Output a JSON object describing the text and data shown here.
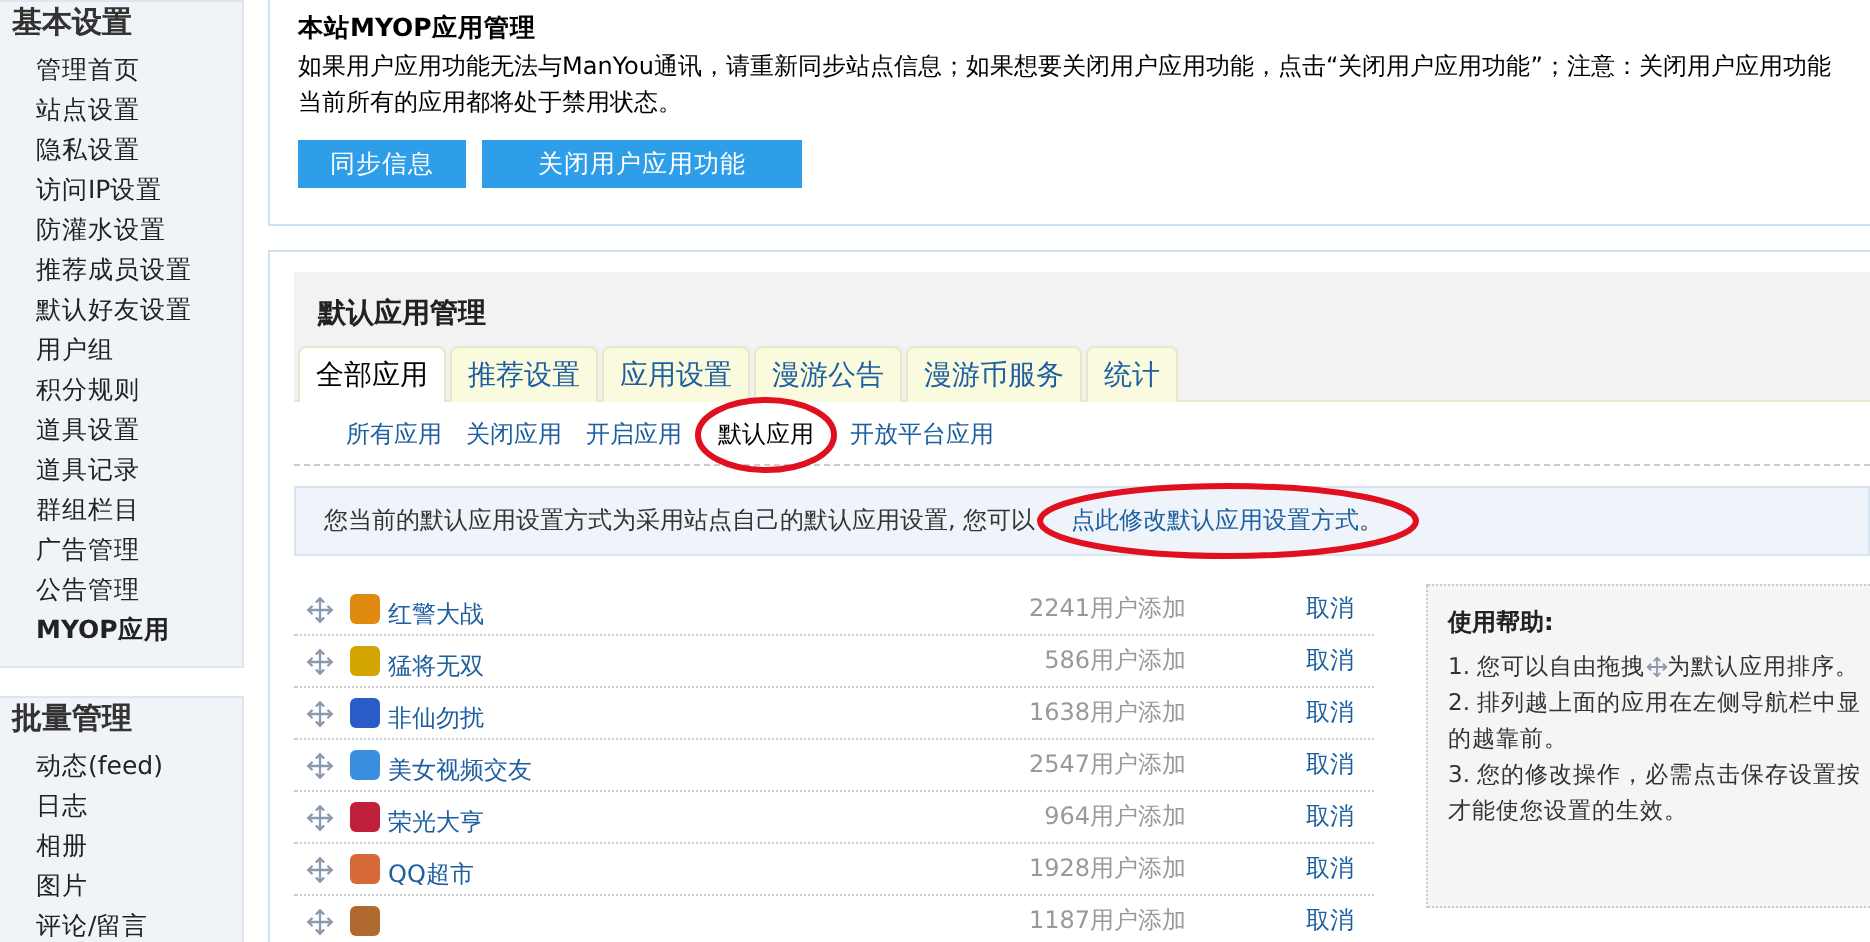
{
  "sidebar": [
    {
      "title": "基本设置",
      "items": [
        {
          "label": "管理首页",
          "selected": false
        },
        {
          "label": "站点设置",
          "selected": false
        },
        {
          "label": "隐私设置",
          "selected": false
        },
        {
          "label": "访问IP设置",
          "selected": false
        },
        {
          "label": "防灌水设置",
          "selected": false
        },
        {
          "label": "推荐成员设置",
          "selected": false
        },
        {
          "label": "默认好友设置",
          "selected": false
        },
        {
          "label": "用户组",
          "selected": false
        },
        {
          "label": "积分规则",
          "selected": false
        },
        {
          "label": "道具设置",
          "selected": false
        },
        {
          "label": "道具记录",
          "selected": false
        },
        {
          "label": "群组栏目",
          "selected": false
        },
        {
          "label": "广告管理",
          "selected": false
        },
        {
          "label": "公告管理",
          "selected": false
        },
        {
          "label": "MYOP应用",
          "selected": true
        }
      ]
    },
    {
      "title": "批量管理",
      "items": [
        {
          "label": "动态(feed)",
          "selected": false
        },
        {
          "label": "日志",
          "selected": false
        },
        {
          "label": "相册",
          "selected": false
        },
        {
          "label": "图片",
          "selected": false
        },
        {
          "label": "评论/留言",
          "selected": false
        }
      ]
    }
  ],
  "notice": {
    "title": "本站MYOP应用管理",
    "lines": [
      "如果用户应用功能无法与ManYou通讯，请重新同步站点信息；如果想要关闭用户应用功能，点击“关闭用户应用功能”；注意：关闭用户应用功能",
      "当前所有的应用都将处于禁用状态。"
    ],
    "buttons": [
      "同步信息",
      "关闭用户应用功能"
    ]
  },
  "panel": {
    "title": "默认应用管理",
    "tabs": [
      {
        "label": "全部应用",
        "selected": true
      },
      {
        "label": "推荐设置",
        "selected": false
      },
      {
        "label": "应用设置",
        "selected": false
      },
      {
        "label": "漫游公告",
        "selected": false
      },
      {
        "label": "漫游币服务",
        "selected": false
      },
      {
        "label": "统计",
        "selected": false
      }
    ],
    "subtabs": [
      {
        "label": "所有应用",
        "selected": false
      },
      {
        "label": "关闭应用",
        "selected": false
      },
      {
        "label": "开启应用",
        "selected": false
      },
      {
        "label": "默认应用",
        "selected": true
      },
      {
        "label": "开放平台应用",
        "selected": false
      }
    ],
    "info": {
      "text": "您当前的默认应用设置方式为采用站点自己的默认应用设置, 您可以",
      "link": "点此修改默认应用设置方式",
      "end": "。"
    },
    "apps": [
      {
        "name": "红警大战",
        "count": "2241用户添加",
        "action": "取消",
        "color": "#e08a10"
      },
      {
        "name": "猛将无双",
        "count": "586用户添加",
        "action": "取消",
        "color": "#d4a500"
      },
      {
        "name": "非仙勿扰",
        "count": "1638用户添加",
        "action": "取消",
        "color": "#2a5cc8"
      },
      {
        "name": "美女视频交友",
        "count": "2547用户添加",
        "action": "取消",
        "color": "#3a8ee0"
      },
      {
        "name": "荣光大亨",
        "count": "964用户添加",
        "action": "取消",
        "color": "#c0203a"
      },
      {
        "name": "QQ超市",
        "count": "1928用户添加",
        "action": "取消",
        "color": "#d86a3a"
      },
      {
        "count": "1187用户添加",
        "action": "取消",
        "color": "#b06a30"
      }
    ],
    "help": {
      "title": "使用帮助:",
      "items": [
        {
          "kind": "with-icon",
          "before": "1. 您可以自由拖拽",
          "after": "为默认应用排序。"
        },
        {
          "kind": "text",
          "lines": [
            "2. 排列越上面的应用在左侧导航栏中显",
            "的越靠前。"
          ]
        },
        {
          "kind": "text",
          "lines": [
            "3. 您的修改操作，必需点击保存设置按",
            "才能使您设置的生效。"
          ]
        }
      ]
    }
  }
}
